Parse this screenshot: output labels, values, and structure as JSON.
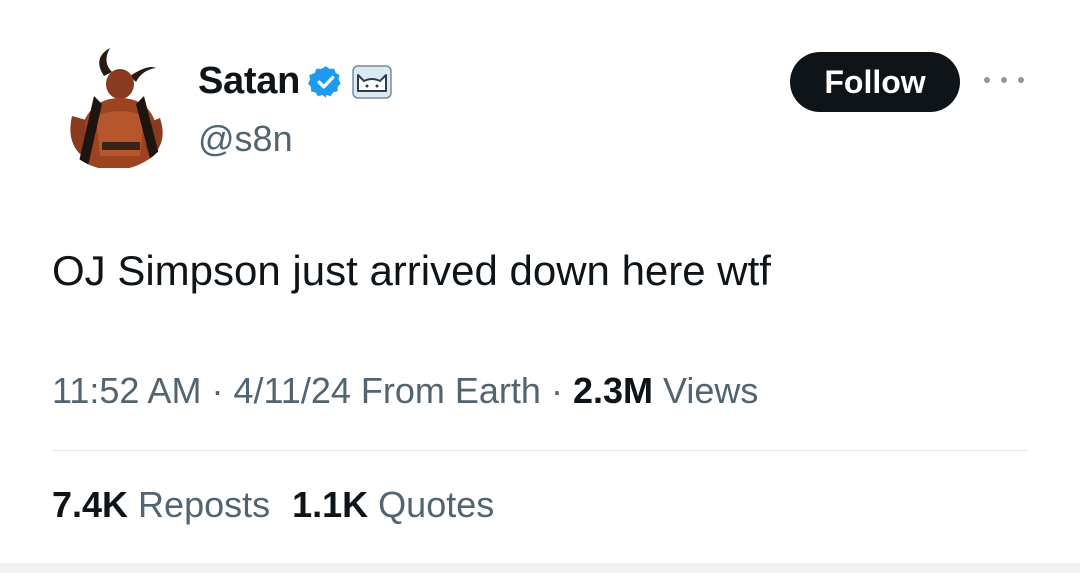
{
  "author": {
    "display_name": "Satan",
    "handle": "@s8n",
    "verified_icon": "verified-badge-icon",
    "affiliate_icon": "cat-affiliate-icon",
    "avatar": "devil-avatar"
  },
  "actions": {
    "follow_label": "Follow",
    "more_icon": "more-options-icon"
  },
  "tweet": {
    "text": "OJ Simpson just arrived down here wtf"
  },
  "meta": {
    "time": "11:52 AM",
    "separator1": " · ",
    "date": "4/11/24",
    "source": " From Earth",
    "separator2": " · ",
    "views_count": "2.3M",
    "views_label": " Views"
  },
  "stats": {
    "reposts_count": "7.4K",
    "reposts_label": " Reposts",
    "quotes_count": "1.1K",
    "quotes_label": " Quotes"
  },
  "colors": {
    "verified": "#1d9bf0",
    "follow_bg": "#0f1419",
    "secondary_text": "#536471"
  }
}
